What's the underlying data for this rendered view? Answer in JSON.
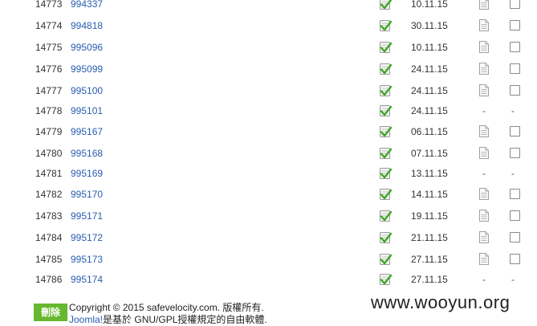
{
  "rows": [
    {
      "id": "14773",
      "code": "994337",
      "date": "10.11.15",
      "has_doc": true
    },
    {
      "id": "14774",
      "code": "994818",
      "date": "30.11.15",
      "has_doc": true
    },
    {
      "id": "14775",
      "code": "995096",
      "date": "10.11.15",
      "has_doc": true
    },
    {
      "id": "14776",
      "code": "995099",
      "date": "24.11.15",
      "has_doc": true
    },
    {
      "id": "14777",
      "code": "995100",
      "date": "24.11.15",
      "has_doc": true
    },
    {
      "id": "14778",
      "code": "995101",
      "date": "24.11.15",
      "has_doc": false
    },
    {
      "id": "14779",
      "code": "995167",
      "date": "06.11.15",
      "has_doc": true
    },
    {
      "id": "14780",
      "code": "995168",
      "date": "07.11.15",
      "has_doc": true
    },
    {
      "id": "14781",
      "code": "995169",
      "date": "13.11.15",
      "has_doc": false
    },
    {
      "id": "14782",
      "code": "995170",
      "date": "14.11.15",
      "has_doc": true
    },
    {
      "id": "14783",
      "code": "995171",
      "date": "19.11.15",
      "has_doc": true
    },
    {
      "id": "14784",
      "code": "995172",
      "date": "21.11.15",
      "has_doc": true
    },
    {
      "id": "14785",
      "code": "995173",
      "date": "27.11.15",
      "has_doc": true
    },
    {
      "id": "14786",
      "code": "995174",
      "date": "27.11.15",
      "has_doc": false
    }
  ],
  "dash": "-",
  "delete_label": "刪除",
  "footer": {
    "line1": "Copyright © 2015 safevelocity.com. 版權所有.",
    "joomla_link": "Joomla!",
    "line2_rest": "是基於 GNU/GPL授權規定的自由軟體."
  },
  "watermark": "www.wooyun.org",
  "colors": {
    "link": "#2a5db0",
    "delete_button": "#66b82e"
  }
}
